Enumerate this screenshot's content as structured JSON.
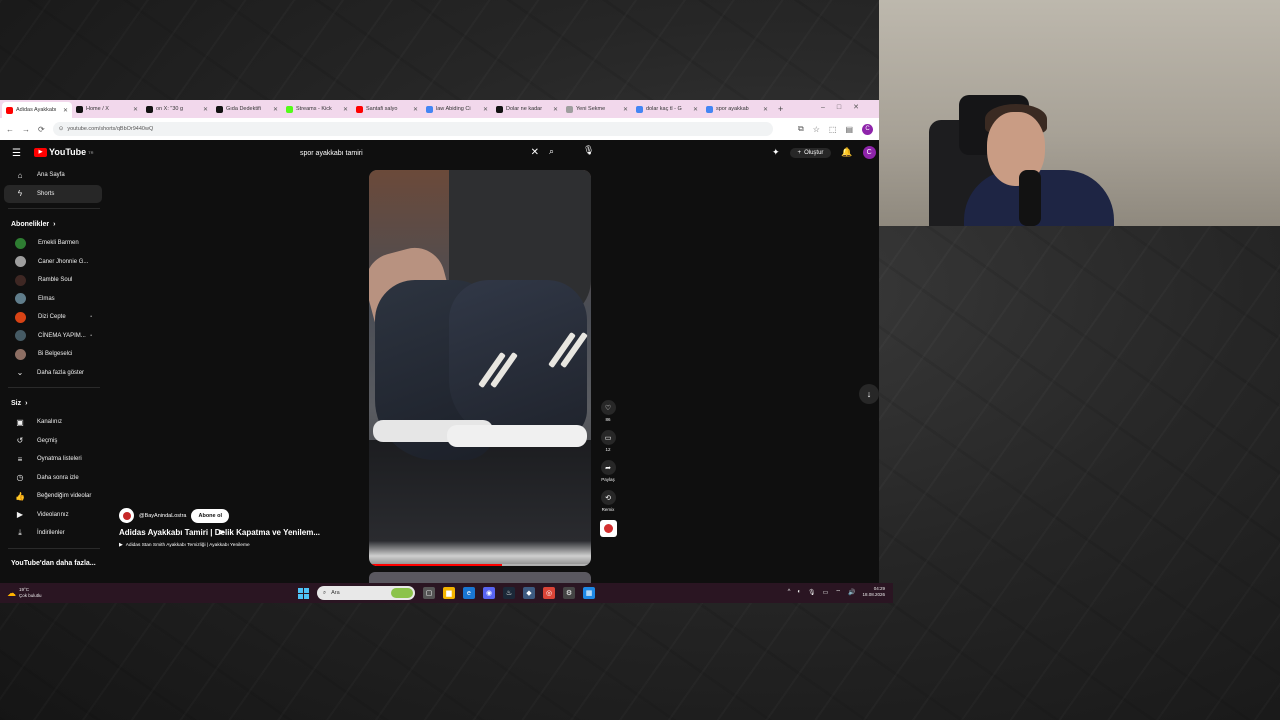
{
  "browser": {
    "tabs": [
      {
        "label": "Adidas Ayakkabı",
        "color": "#ff0000",
        "active": true
      },
      {
        "label": "Home / X",
        "color": "#111111"
      },
      {
        "label": "on X: \"30 g",
        "color": "#111111"
      },
      {
        "label": "Gıda Dedektifi",
        "color": "#111111"
      },
      {
        "label": "Streams - Kick",
        "color": "#53fc18"
      },
      {
        "label": "Santafi salyo",
        "color": "#ff0000"
      },
      {
        "label": "law Abiding Ci",
        "color": "#4285f4"
      },
      {
        "label": "Dolar ne kadar",
        "color": "#111111"
      },
      {
        "label": "Yeni Sekme",
        "color": "#9e9e9e"
      },
      {
        "label": "dolar kaç tl - G",
        "color": "#4285f4"
      },
      {
        "label": "spor ayakkab",
        "color": "#4285f4"
      }
    ],
    "url": "youtube.com/shorts/qBbOr9440wQ",
    "profile_initial": "C"
  },
  "youtube": {
    "logo_text": "YouTube",
    "logo_sup": "TR",
    "search_query": "spor ayakkabı tamiri",
    "create_label": "Oluştur",
    "user_initial": "C"
  },
  "sidebar": {
    "main": [
      {
        "label": "Ana Sayfa",
        "icon": "home-icon",
        "glyph": "⌂"
      },
      {
        "label": "Shorts",
        "icon": "shorts-icon",
        "glyph": "ϟ",
        "active": true
      }
    ],
    "subscriptions_header": "Abonelikler",
    "subscriptions": [
      {
        "label": "Emekli Barmen",
        "color": "#2e7d32"
      },
      {
        "label": "Caner Jhonnie G...",
        "color": "#9e9e9e"
      },
      {
        "label": "Ramble Soul",
        "color": "#3e2723",
        "glyph": "ʀ"
      },
      {
        "label": "Elmas",
        "color": "#607d8b",
        "glyph": "☰"
      },
      {
        "label": "Dizi Cepte",
        "color": "#d84315",
        "dot": true
      },
      {
        "label": "CİNEMA YAPIM...",
        "color": "#455a64",
        "dot": true
      },
      {
        "label": "Bi Belgeselci",
        "color": "#8d6e63"
      }
    ],
    "show_more": "Daha fazla göster",
    "you_header": "Siz",
    "you": [
      {
        "label": "Kanalınız",
        "icon": "channel-icon",
        "glyph": "▣"
      },
      {
        "label": "Geçmiş",
        "icon": "history-icon",
        "glyph": "↺"
      },
      {
        "label": "Oynatma listeleri",
        "icon": "playlists-icon",
        "glyph": "≡"
      },
      {
        "label": "Daha sonra izle",
        "icon": "watch-later-icon",
        "glyph": "◷"
      },
      {
        "label": "Beğendiğim videolar",
        "icon": "liked-icon",
        "glyph": "👍"
      },
      {
        "label": "Videolarınız",
        "icon": "your-videos-icon",
        "glyph": "▶"
      },
      {
        "label": "İndirilenler",
        "icon": "downloads-icon",
        "glyph": "⤓"
      }
    ],
    "more_header": "YouTube'dan daha fazla..."
  },
  "short": {
    "likes": "86",
    "comments": "12",
    "share_label": "Paylaş",
    "remix_label": "Remix",
    "channel_handle": "@BayAnindaLostra",
    "subscribe_label": "Abone ol",
    "title": "Adidas Ayakkabı Tamiri | Delik Kapatma ve Yenilem...",
    "playlist": "Adidas Stan Smith Ayakkabı Temizliği | Ayakkabı Yenileme",
    "progress": 0.6
  },
  "taskbar": {
    "weather_temp": "19°C",
    "weather_desc": "Çok bulutlu",
    "search_placeholder": "Ara",
    "time": "04:29",
    "date": "18.08.2026"
  }
}
